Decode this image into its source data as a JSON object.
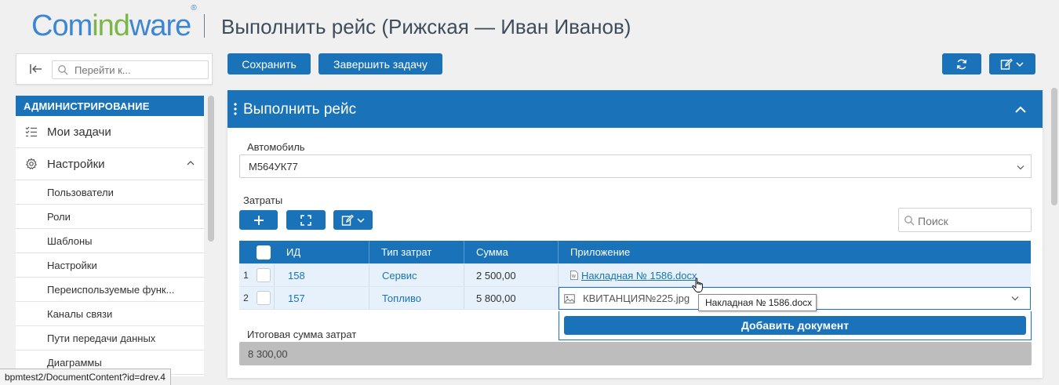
{
  "app": {
    "logo_com": "Com",
    "logo_ind": "ind",
    "logo_ware": "ware",
    "logo_reg": "®",
    "title": "Выполнить рейс (Рижская — Иван Иванов)"
  },
  "sidebar": {
    "search_placeholder": "Перейти к...",
    "section": "АДМИНИСТРИРОВАНИЕ",
    "items": [
      {
        "label": "Мои задачи",
        "icon": "task-list-icon"
      },
      {
        "label": "Настройки",
        "icon": "gear-icon"
      }
    ],
    "subitems": [
      "Пользователи",
      "Роли",
      "Шаблоны",
      "Настройки",
      "Переиспользуемые функ...",
      "Каналы связи",
      "Пути передачи данных",
      "Диаграммы"
    ]
  },
  "toolbar": {
    "save_label": "Сохранить",
    "finish_label": "Завершить задачу"
  },
  "panel": {
    "title": "Выполнить рейс",
    "vehicle_label": "Автомобиль",
    "vehicle_value": "М564УК77",
    "costs_label": "Затраты",
    "grid_search_placeholder": "Поиск",
    "columns": {
      "id": "ИД",
      "type": "Тип затрат",
      "sum": "Сумма",
      "attachment": "Приложение"
    },
    "rows": [
      {
        "num": "1",
        "id": "158",
        "type": "Сервис",
        "sum": "2 500,00",
        "attachment": "Накладная № 1586.docx"
      },
      {
        "num": "2",
        "id": "157",
        "type": "Топливо",
        "sum": "5 800,00",
        "attachment": "КВИТАНЦИЯ№225.jpg"
      }
    ],
    "add_document_label": "Добавить документ",
    "tooltip": "Накладная № 1586.docx",
    "total_label": "Итоговая сумма затрат",
    "total_value": "8 300,00"
  },
  "status_bar": "bpmtest2/DocumentContent?id=drev.4",
  "colors": {
    "primary": "#1a73b8",
    "logo_blue": "#3d86d4",
    "logo_green": "#7ab648",
    "row_highlight": "#e6f1fb"
  }
}
